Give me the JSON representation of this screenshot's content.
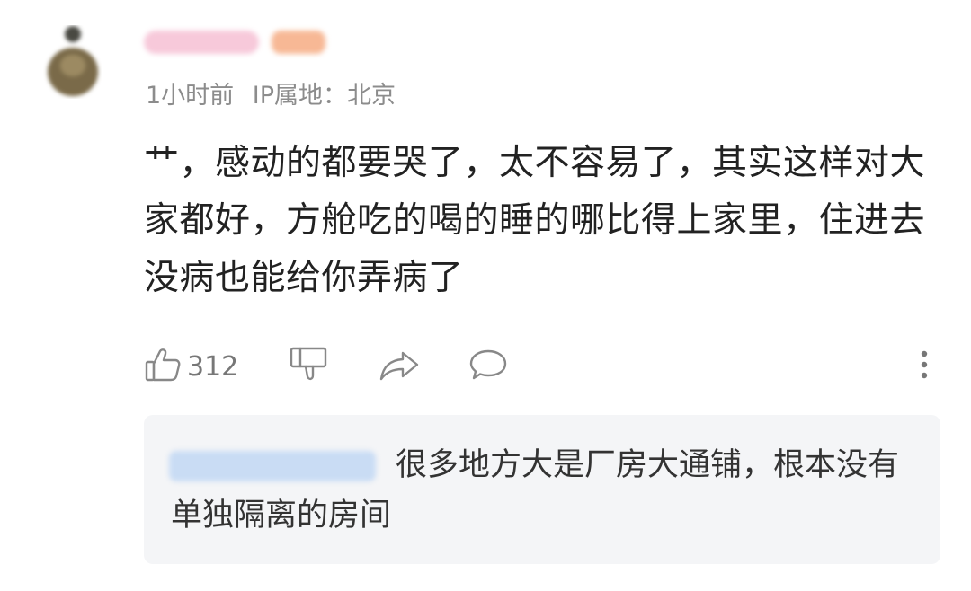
{
  "comment": {
    "meta": {
      "time": "1小时前",
      "ip_location": "IP属地：北京"
    },
    "body": "艹，感动的都要哭了，太不容易了，其实这样对大家都好，方舱吃的喝的睡的哪比得上家里，住进去没病也能给你弄病了",
    "actions": {
      "like_count": "312"
    },
    "reply_quote": {
      "text": "很多地方大是厂房大通铺，根本没有单独隔离的房间"
    }
  },
  "icons": {
    "like": "thumbs-up-icon",
    "dislike": "thumbs-down-icon",
    "share": "share-arrow-icon",
    "reply": "speech-bubble-icon",
    "more": "more-vertical-icon"
  },
  "colors": {
    "text": "#222222",
    "meta": "#8c8c8c",
    "quote_bg": "#f4f5f7",
    "icon": "#888888"
  }
}
